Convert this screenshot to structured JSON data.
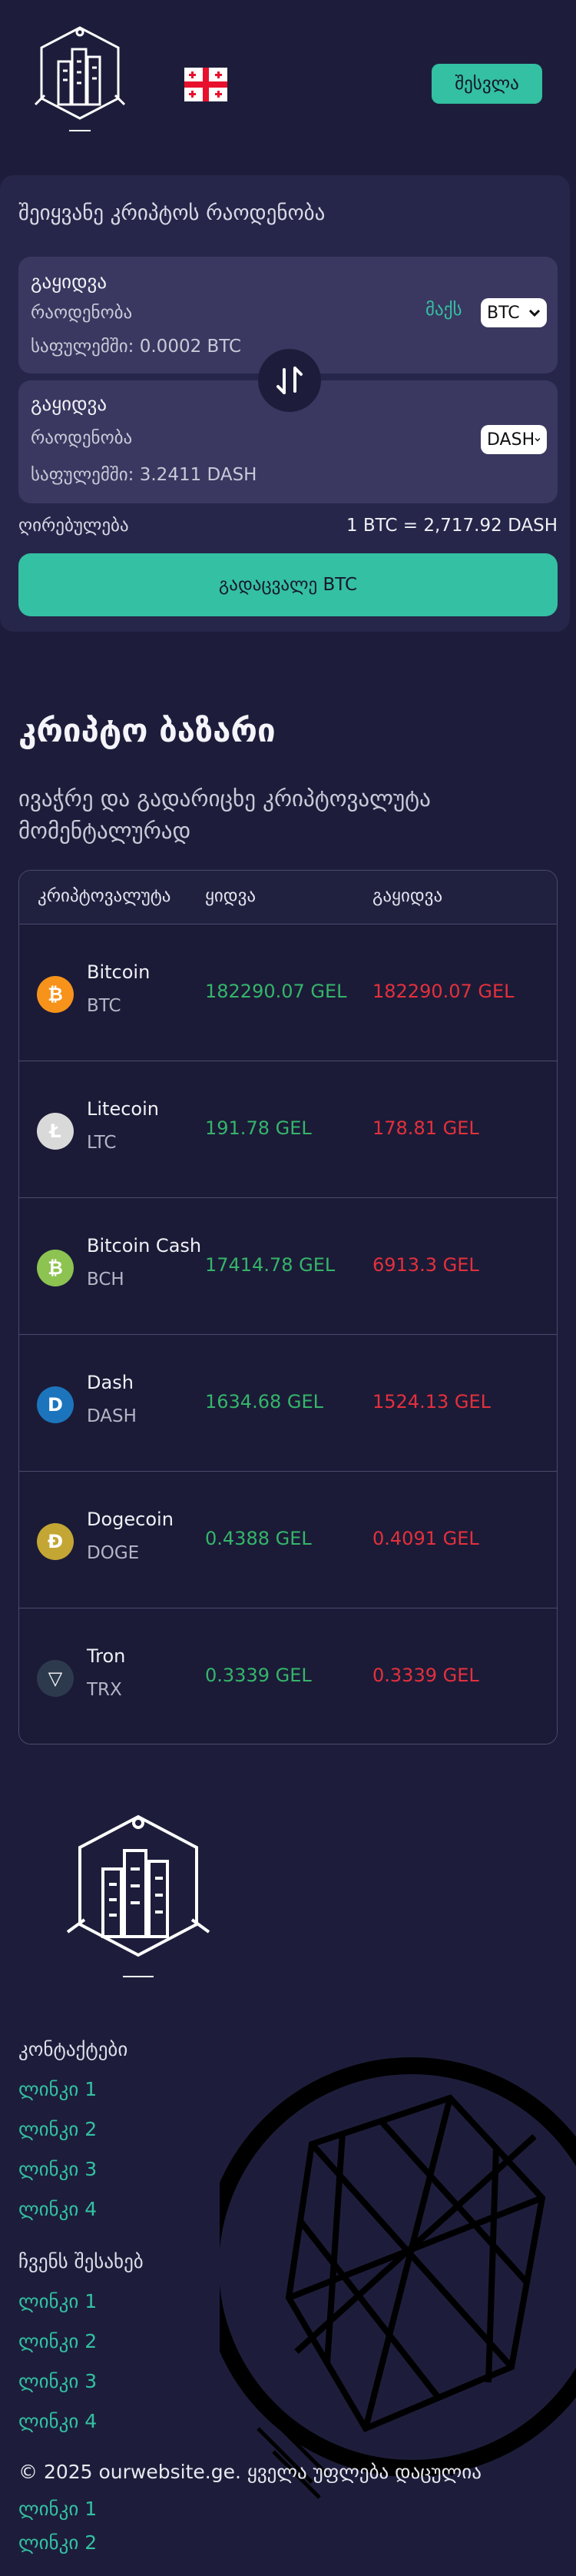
{
  "header": {
    "logo": "logo-emblem",
    "flag": "georgia-flag",
    "login_label": "შესვლა"
  },
  "converter": {
    "title": "შეიყვანე კრიპტოს რაოდენობა",
    "from": {
      "action": "გაყიდვა",
      "amount_label": "რაოდენობა",
      "min_label": "საფულემში: 0.0002 BTC",
      "max_label": "მაქს",
      "currency": "BTC"
    },
    "to": {
      "action": "გაყიდვა",
      "amount_label": "რაოდენობა",
      "min_label": "საფულემში: 3.2411 DASH",
      "currency": "DASH"
    },
    "swap_icon": "swap-arrows-icon",
    "rate_label": "ღირებულება",
    "rate_value": "1 BTC = 2,717.92 DASH",
    "exchange_label": "გადაცვალე BTC"
  },
  "market": {
    "title": "კრიპტო ბაზარი",
    "subtitle": "ივაჭრე და გადარიცხე კრიპტოვალუტა მომენტალურად",
    "columns": [
      "კრიპტოვალუტა",
      "ყიდვა",
      "გაყიდვა"
    ],
    "rows": [
      {
        "name": "Bitcoin",
        "symbol": "BTC",
        "buy": "182290.07 GEL",
        "sell": "182290.07 GEL",
        "icon": "bitcoin-icon",
        "color": "#f7931a",
        "glyph": "₿"
      },
      {
        "name": "Litecoin",
        "symbol": "LTC",
        "buy": "191.78 GEL",
        "sell": "178.81 GEL",
        "icon": "litecoin-icon",
        "color": "#d9d9d9",
        "glyph": "Ł"
      },
      {
        "name": "Bitcoin Cash",
        "symbol": "BCH",
        "buy": "17414.78 GEL",
        "sell": "6913.3 GEL",
        "icon": "bitcoin-cash-icon",
        "color": "#8dc351",
        "glyph": "₿"
      },
      {
        "name": "Dash",
        "symbol": "DASH",
        "buy": "1634.68 GEL",
        "sell": "1524.13 GEL",
        "icon": "dash-icon",
        "color": "#1c75bc",
        "glyph": "D"
      },
      {
        "name": "Dogecoin",
        "symbol": "DOGE",
        "buy": "0.4388 GEL",
        "sell": "0.4091 GEL",
        "icon": "dogecoin-icon",
        "color": "#c3a634",
        "glyph": "Ð"
      },
      {
        "name": "Tron",
        "symbol": "TRX",
        "buy": "0.3339 GEL",
        "sell": "0.3339 GEL",
        "icon": "tron-icon",
        "color": "#2d3a4e",
        "glyph": "▽"
      }
    ]
  },
  "footer": {
    "contacts_heading": "კონტაქტები",
    "contacts_links": [
      "ლინკი 1",
      "ლინკი 2",
      "ლინკი 3",
      "ლინკი 4"
    ],
    "about_heading": "ჩვენს შესახებ",
    "about_links": [
      "ლინკი 1",
      "ლინკი 2",
      "ლინკი 3",
      "ლინკი 4"
    ],
    "copyright": "© 2025 ourwebsite.ge. ყველა უფლება დაცულია",
    "bottom_links": [
      "ლინკი 1",
      "ლინკი 2"
    ]
  },
  "colors": {
    "background": "#1d1d3b",
    "accent": "#34c0a2",
    "buy": "#35b56a",
    "sell": "#e4303c"
  }
}
